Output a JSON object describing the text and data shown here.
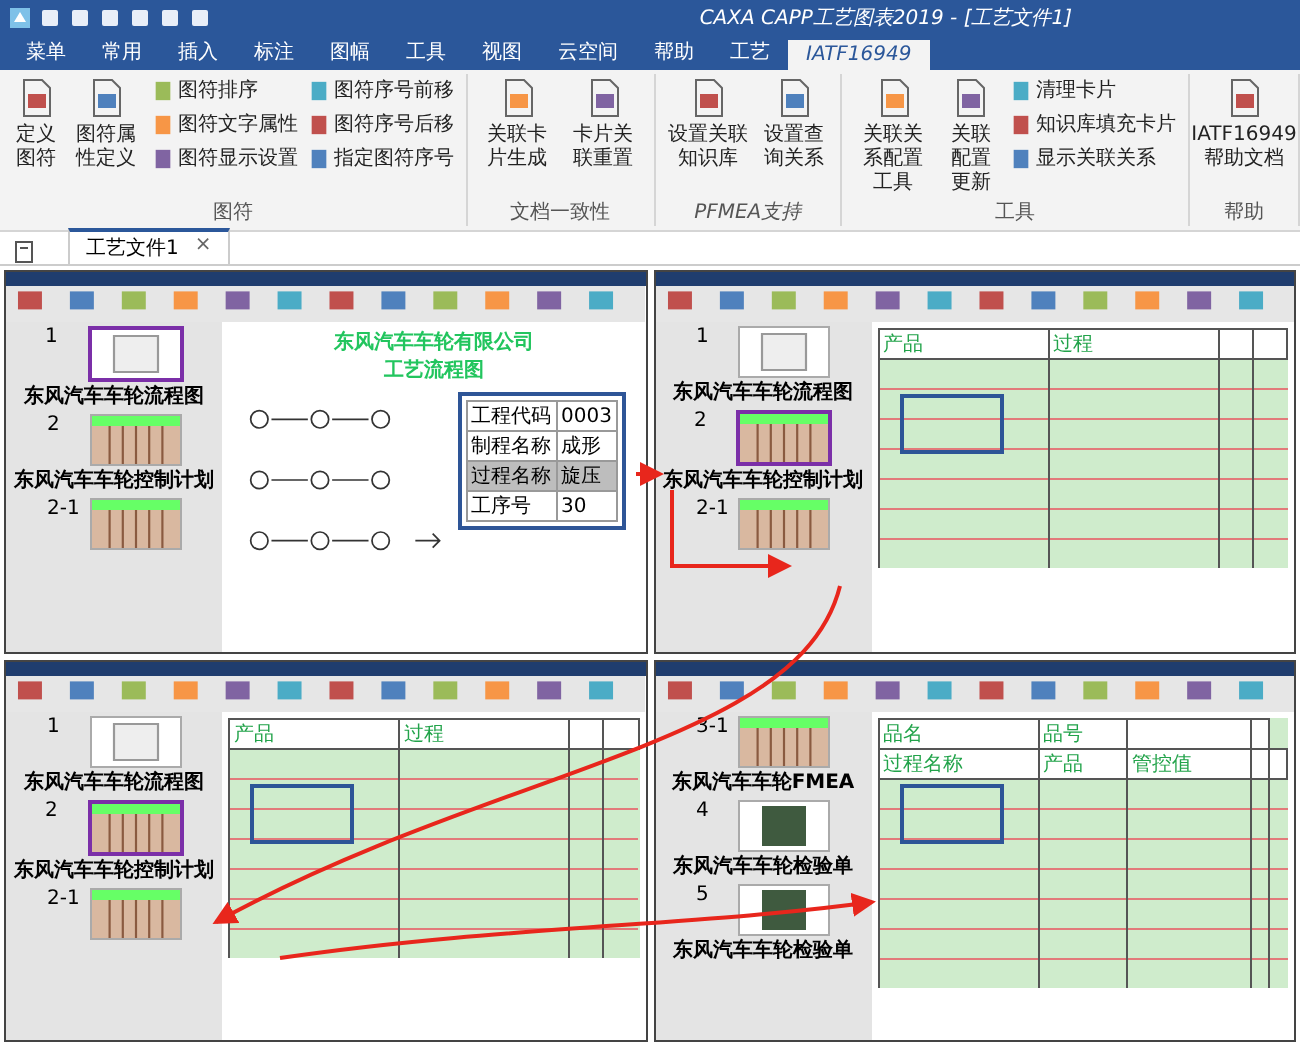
{
  "window": {
    "title": "CAXA CAPP工艺图表2019 - [工艺文件1]"
  },
  "tabs": [
    {
      "label": "菜单",
      "selected": false
    },
    {
      "label": "常用",
      "selected": false
    },
    {
      "label": "插入",
      "selected": false
    },
    {
      "label": "标注",
      "selected": false
    },
    {
      "label": "图幅",
      "selected": false
    },
    {
      "label": "工具",
      "selected": false
    },
    {
      "label": "视图",
      "selected": false
    },
    {
      "label": "云空间",
      "selected": false
    },
    {
      "label": "帮助",
      "selected": false
    },
    {
      "label": "工艺",
      "selected": false
    },
    {
      "label": "IATF16949",
      "selected": true
    }
  ],
  "ribbon_groups": [
    {
      "label": "图符",
      "italic": false,
      "buttons": [
        {
          "kind": "large",
          "label": "定义图符"
        },
        {
          "kind": "large",
          "label": "图符属性定义"
        },
        {
          "kind": "small",
          "label": "图符排序"
        },
        {
          "kind": "small",
          "label": "图符文字属性"
        },
        {
          "kind": "small",
          "label": "图符显示设置"
        },
        {
          "kind": "small",
          "label": "图符序号前移"
        },
        {
          "kind": "small",
          "label": "图符序号后移"
        },
        {
          "kind": "small",
          "label": "指定图符序号"
        }
      ]
    },
    {
      "label": "文档一致性",
      "italic": false,
      "buttons": [
        {
          "kind": "large",
          "label": "关联卡片生成"
        },
        {
          "kind": "large",
          "label": "卡片关联重置"
        }
      ]
    },
    {
      "label": "PFMEA支持",
      "italic": true,
      "buttons": [
        {
          "kind": "large",
          "label": "设置关联知识库"
        },
        {
          "kind": "large",
          "label": "设置查询关系"
        }
      ]
    },
    {
      "label": "工具",
      "italic": false,
      "buttons": [
        {
          "kind": "large",
          "label": "关联关系配置工具"
        },
        {
          "kind": "large",
          "label": "关联配置更新"
        },
        {
          "kind": "small",
          "label": "清理卡片"
        },
        {
          "kind": "small",
          "label": "知识库填充卡片"
        },
        {
          "kind": "small",
          "label": "显示关联关系"
        }
      ]
    },
    {
      "label": "帮助",
      "italic": false,
      "buttons": [
        {
          "kind": "large",
          "label": "IATF16949帮助文档"
        }
      ]
    }
  ],
  "document_tabs": [
    {
      "label": "工艺文件1",
      "close": "×",
      "selected": true
    }
  ],
  "screenshots": [
    {
      "kind": "flowchart",
      "thumbnails": [
        {
          "number": "1",
          "kind": "sheet",
          "caption": "东风汽车车轮流程图",
          "selected": true
        },
        {
          "number": "2",
          "kind": "table",
          "caption": "东风汽车车轮控制计划",
          "selected": false
        },
        {
          "number": "2-1",
          "kind": "table",
          "selected": false
        }
      ],
      "title": "东风汽车车轮有限公司",
      "subtitle": "工艺流程图",
      "info": [
        {
          "label": "工程代码",
          "value": "0003",
          "selected": false
        },
        {
          "label": "制程名称",
          "value": "成形",
          "selected": false
        },
        {
          "label": "过程名称",
          "value": "旋压",
          "selected": true
        },
        {
          "label": "工序号",
          "value": "30",
          "selected": false
        }
      ]
    },
    {
      "kind": "form",
      "thumbnails": [
        {
          "number": "1",
          "kind": "sheet",
          "caption": "东风汽车车轮流程图",
          "selected": false
        },
        {
          "number": "2",
          "kind": "table",
          "caption": "东风汽车车轮控制计划",
          "selected": true
        },
        {
          "number": "2-1",
          "kind": "table",
          "selected": false
        }
      ],
      "header_rows": [
        [
          "产品",
          "过程"
        ]
      ]
    },
    {
      "kind": "form",
      "thumbnails": [
        {
          "number": "1",
          "kind": "sheet",
          "caption": "东风汽车车轮流程图",
          "selected": false
        },
        {
          "number": "2",
          "kind": "table",
          "caption": "东风汽车车轮控制计划",
          "selected": true
        },
        {
          "number": "2-1",
          "kind": "table",
          "selected": false
        }
      ],
      "header_rows": [
        [
          "产品",
          "过程"
        ]
      ]
    },
    {
      "kind": "form",
      "thumbnails": [
        {
          "number": "3-1",
          "kind": "table",
          "caption": "东风汽车车轮FMEA",
          "selected": false
        },
        {
          "number": "4",
          "kind": "dark",
          "caption": "东风汽车车轮检验单",
          "selected": false
        },
        {
          "number": "5",
          "kind": "dark",
          "caption": "东风汽车车轮检验单",
          "selected": false
        }
      ],
      "header_rows": [
        [
          "品名",
          "品号"
        ],
        [
          "过程名称",
          "产品",
          "管控值"
        ]
      ]
    }
  ]
}
